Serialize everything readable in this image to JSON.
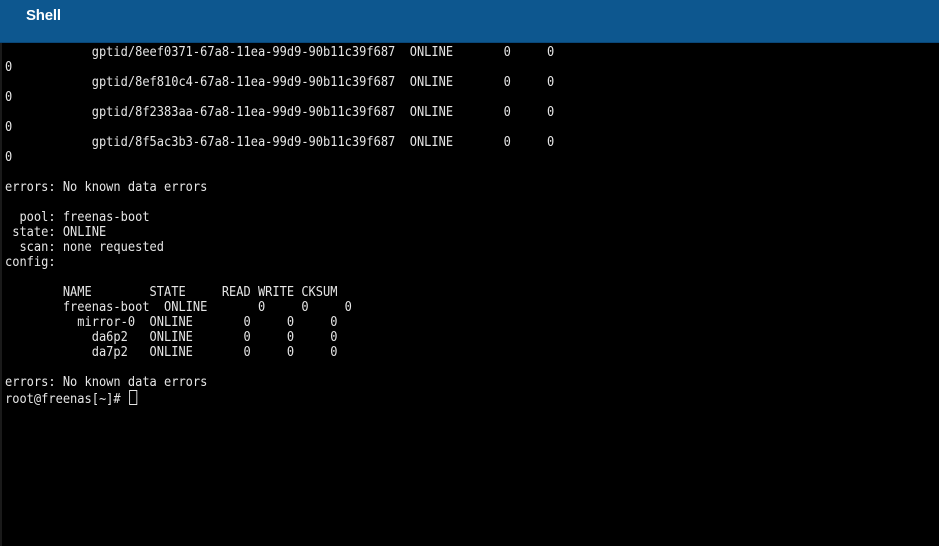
{
  "header": {
    "title": "Shell"
  },
  "terminal": {
    "lines": [
      "            gptid/8eef0371-67a8-11ea-99d9-90b11c39f687  ONLINE       0     0",
      "0",
      "            gptid/8ef810c4-67a8-11ea-99d9-90b11c39f687  ONLINE       0     0",
      "0",
      "            gptid/8f2383aa-67a8-11ea-99d9-90b11c39f687  ONLINE       0     0",
      "0",
      "            gptid/8f5ac3b3-67a8-11ea-99d9-90b11c39f687  ONLINE       0     0",
      "0",
      "",
      "errors: No known data errors",
      "",
      "  pool: freenas-boot",
      " state: ONLINE",
      "  scan: none requested",
      "config:",
      "",
      "        NAME        STATE     READ WRITE CKSUM",
      "        freenas-boot  ONLINE       0     0     0",
      "          mirror-0  ONLINE       0     0     0",
      "            da6p2   ONLINE       0     0     0",
      "            da7p2   ONLINE       0     0     0",
      "",
      "errors: No known data errors"
    ],
    "prompt": "root@freenas[~]# "
  }
}
